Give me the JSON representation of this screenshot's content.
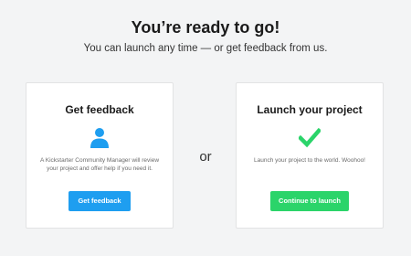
{
  "header": {
    "title": "You’re ready to go!",
    "subtitle": "You can launch any time — or get feedback from us."
  },
  "feedback_card": {
    "title": "Get feedback",
    "icon": "person-icon",
    "description": "A Kickstarter Community Manager will review your project and offer help if you need it.",
    "button_label": "Get feedback",
    "button_color": "#1e9ef0",
    "icon_color": "#1e9ef0"
  },
  "separator": {
    "label": "or"
  },
  "launch_card": {
    "title": "Launch your project",
    "icon": "checkmark-icon",
    "description": "Launch your project to the world. Woohoo!",
    "button_label": "Continue to launch",
    "button_color": "#2bd46a",
    "icon_color": "#2bd46a"
  }
}
